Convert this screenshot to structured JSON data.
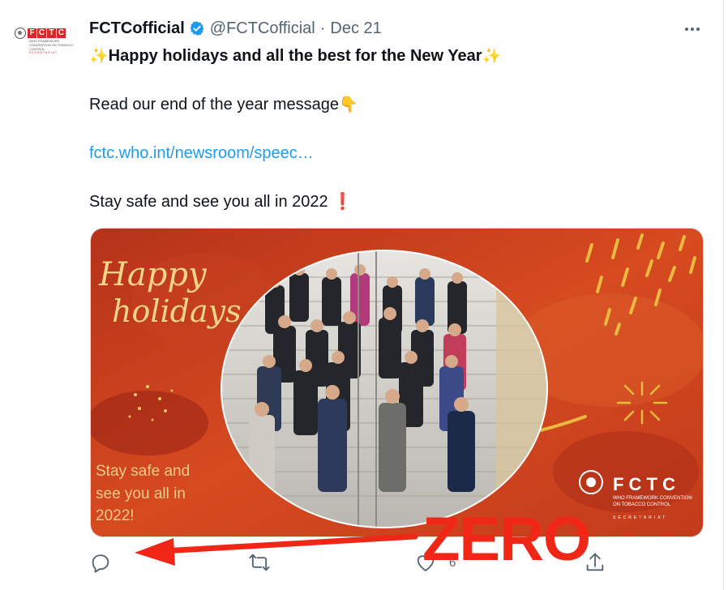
{
  "tweet": {
    "author_name": "FCTCofficial",
    "handle": "@FCTCofficial",
    "separator": "·",
    "date": "Dec 21",
    "avatar_text": {
      "letters": [
        "F",
        "C",
        "T",
        "C"
      ],
      "subtitle": "WHO FRAMEWORK CONVENTION ON TOBACCO CONTROL",
      "secretariat": "SECRETARIAT"
    },
    "icons": {
      "verified": "verified-badge-icon",
      "more": "more-options-icon",
      "sparkles": "sparkles-emoji",
      "pointing_down": "pointing-down-emoji",
      "exclamation": "red-exclamation-emoji"
    },
    "text": {
      "line1": "Happy holidays and all the best for the New Year",
      "line2": "Read our end of the year message",
      "link": "fctc.who.int/newsroom/speec…",
      "line4": "Stay safe and see you all in 2022"
    },
    "image": {
      "greeting_line1": "Happy",
      "greeting_line2": "holidays",
      "stay_line1": "Stay safe and",
      "stay_line2": "see you all in",
      "stay_line3": "2022!",
      "logo_letters": "F C T C",
      "logo_line1": "WHO FRAMEWORK CONVENTION",
      "logo_line2": "ON TOBACCO CONTROL",
      "logo_line3": "SECRETARIAT"
    },
    "actions": {
      "reply_icon": "reply-icon",
      "retweet_icon": "retweet-icon",
      "like_icon": "like-heart-icon",
      "like_count": "6",
      "share_icon": "share-icon"
    }
  },
  "annotation": {
    "label": "ZERO",
    "color": "#f02617",
    "arrow": "red-arrow-pointing-to-reply"
  },
  "colors": {
    "link": "#1d9bf0",
    "secondary_text": "#536471",
    "verified": "#1d9bf0",
    "image_red": "#c8371c"
  }
}
